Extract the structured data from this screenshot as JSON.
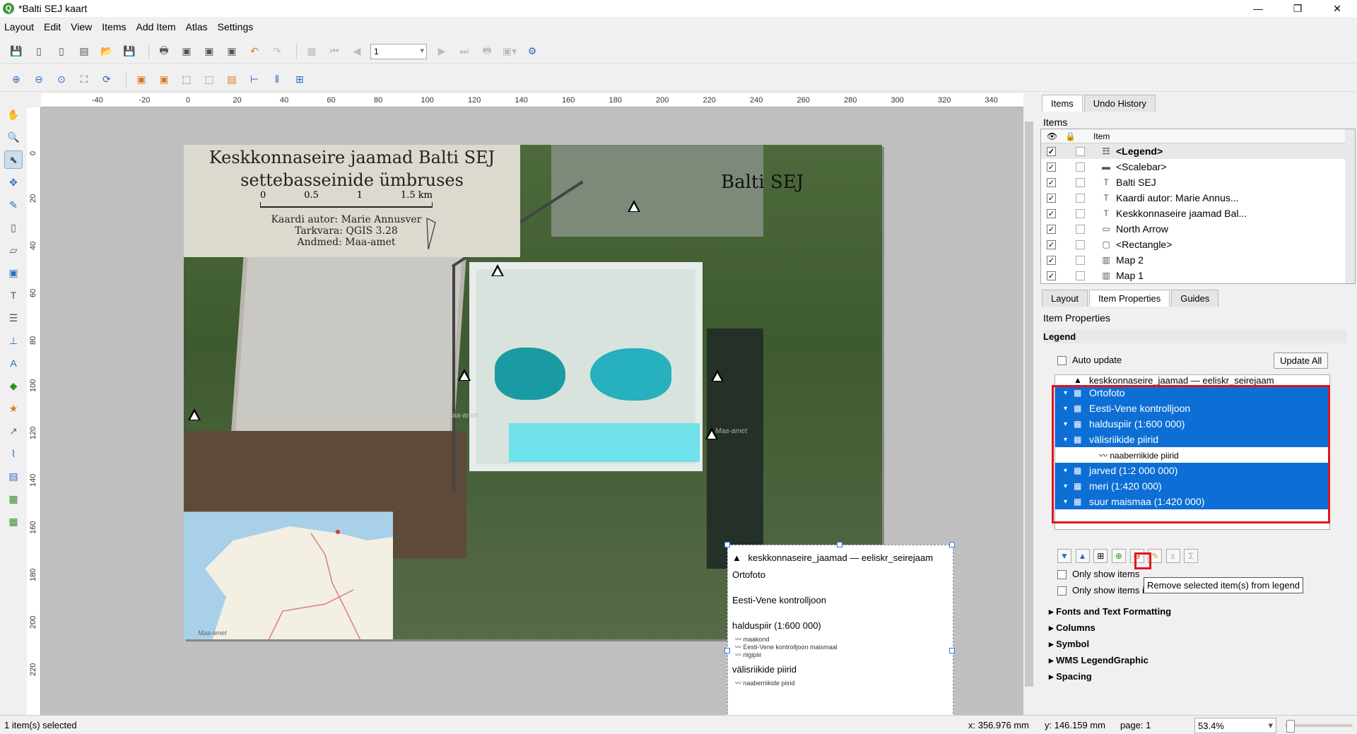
{
  "window": {
    "title": "*Balti SEJ kaart",
    "minimize": "—",
    "restore": "❐",
    "close": "✕"
  },
  "menu": [
    "Layout",
    "Edit",
    "View",
    "Items",
    "Add Item",
    "Atlas",
    "Settings"
  ],
  "toolbar": {
    "page_value": "1"
  },
  "ruler": {
    "h_ticks": [
      "-40",
      "-20",
      "0",
      "20",
      "40",
      "60",
      "80",
      "100",
      "120",
      "140",
      "160",
      "180",
      "200",
      "220",
      "240",
      "260",
      "280",
      "300",
      "320",
      "340"
    ],
    "v_ticks": [
      "0",
      "20",
      "40",
      "60",
      "80",
      "100",
      "120",
      "140",
      "160",
      "180",
      "200",
      "220"
    ]
  },
  "layout": {
    "map_title_line1": "Keskkonnaseire jaamad Balti SEJ",
    "map_title_line2": "settebasseinide ümbruses",
    "scale_labels": [
      "0",
      "0.5",
      "1",
      "1.5 km"
    ],
    "credit_author": "Kaardi autor: Marie Annusver",
    "credit_software": "Tarkvara: QGIS 3.28",
    "credit_data": "Andmed: Maa-amet",
    "map_label": "Balti SEJ",
    "inset_credit": "Maa-amet",
    "watermark1": "aa-amet",
    "watermark2": "Maa-amet"
  },
  "legend_preview": {
    "title_row": "keskkonnaseire_jaamad — eeliskr_seirejaam",
    "entries": [
      "Ortofoto",
      "Eesti-Vene kontrolljoon",
      "halduspiir (1:600 000)",
      "välisriikide piirid"
    ],
    "halduspiir_items": [
      "maakond",
      "Eesti-Vene kontrolljoon maismaal",
      "riigipiir"
    ],
    "valisriik_items": [
      "naaberriikide piirid"
    ]
  },
  "right_panel": {
    "tabs_top": [
      "Items",
      "Undo History"
    ],
    "items_title": "Items",
    "items_column": "Item",
    "items": [
      {
        "label": "<Legend>",
        "icon": "legend-icon",
        "checked": true
      },
      {
        "label": "<Scalebar>",
        "icon": "scalebar-icon",
        "checked": true
      },
      {
        "label": "Balti SEJ",
        "icon": "label-icon",
        "checked": true
      },
      {
        "label": "Kaardi autor: Marie Annus...",
        "icon": "label-icon",
        "checked": true
      },
      {
        "label": "Keskkonnaseire jaamad Bal...",
        "icon": "label-icon",
        "checked": true
      },
      {
        "label": "North Arrow",
        "icon": "picture-icon",
        "checked": true
      },
      {
        "label": "<Rectangle>",
        "icon": "rectangle-icon",
        "checked": true
      },
      {
        "label": "Map 2",
        "icon": "map-icon",
        "checked": true
      },
      {
        "label": "Map 1",
        "icon": "map-icon",
        "checked": true
      }
    ],
    "tabs_bottom": [
      "Layout",
      "Item Properties",
      "Guides"
    ],
    "properties_title": "Item Properties",
    "legend_section": "Legend",
    "auto_update": "Auto update",
    "update_all": "Update All",
    "legend_tree": [
      {
        "label": "keskkonnaseire_jaamad — eeliskr_seirejaam",
        "selected": false
      },
      {
        "label": "Ortofoto",
        "selected": true
      },
      {
        "label": "Eesti-Vene kontrolljoon",
        "selected": true
      },
      {
        "label": "halduspiir (1:600 000)",
        "selected": true
      },
      {
        "label": "välisriikide piirid",
        "selected": true
      },
      {
        "label": "naaberriikide piirid",
        "selected": false,
        "child": true
      },
      {
        "label": "jarved (1:2 000 000)",
        "selected": true
      },
      {
        "label": "meri (1:420 000)",
        "selected": true
      },
      {
        "label": "suur maismaa (1:420 000)",
        "selected": true
      }
    ],
    "only_show_items": "Only show items",
    "only_show_atlas": "Only show items inside current atlas feature",
    "tooltip": "Remove selected item(s) from legend",
    "sections": [
      "Fonts and Text Formatting",
      "Columns",
      "Symbol",
      "WMS LegendGraphic",
      "Spacing"
    ]
  },
  "statusbar": {
    "selected": "1 item(s) selected",
    "x": "x: 356.976 mm",
    "y": "y: 146.159 mm",
    "page": "page: 1",
    "zoom": "53.4%"
  }
}
